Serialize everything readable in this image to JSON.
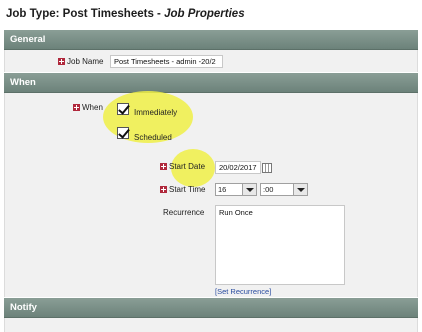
{
  "title": {
    "main": "Job Type: Post Timesheets - ",
    "sub": "Job Properties"
  },
  "sections": {
    "general": "General",
    "when": "When",
    "notify": "Notify"
  },
  "job_name": {
    "label": "Job Name",
    "value": "Post Timesheets - admin -20/2"
  },
  "when": {
    "label": "When",
    "immediately": {
      "label": "Immediately",
      "checked": true
    },
    "scheduled": {
      "label": "Scheduled",
      "checked": true
    }
  },
  "start_date": {
    "label": "Start Date",
    "value": "20/02/2017"
  },
  "start_time": {
    "label": "Start Time",
    "hour": "16",
    "minute": ":00"
  },
  "recurrence": {
    "label": "Recurrence",
    "value": "Run Once",
    "link": "[Set Recurrence]"
  },
  "colors": {
    "section_bar": "#7a8f87",
    "highlight": "#f0f046",
    "required": "#b0283c",
    "link": "#2a4da0"
  },
  "icons": [
    "required-icon",
    "calendar-icon",
    "dropdown-arrow-icon"
  ]
}
